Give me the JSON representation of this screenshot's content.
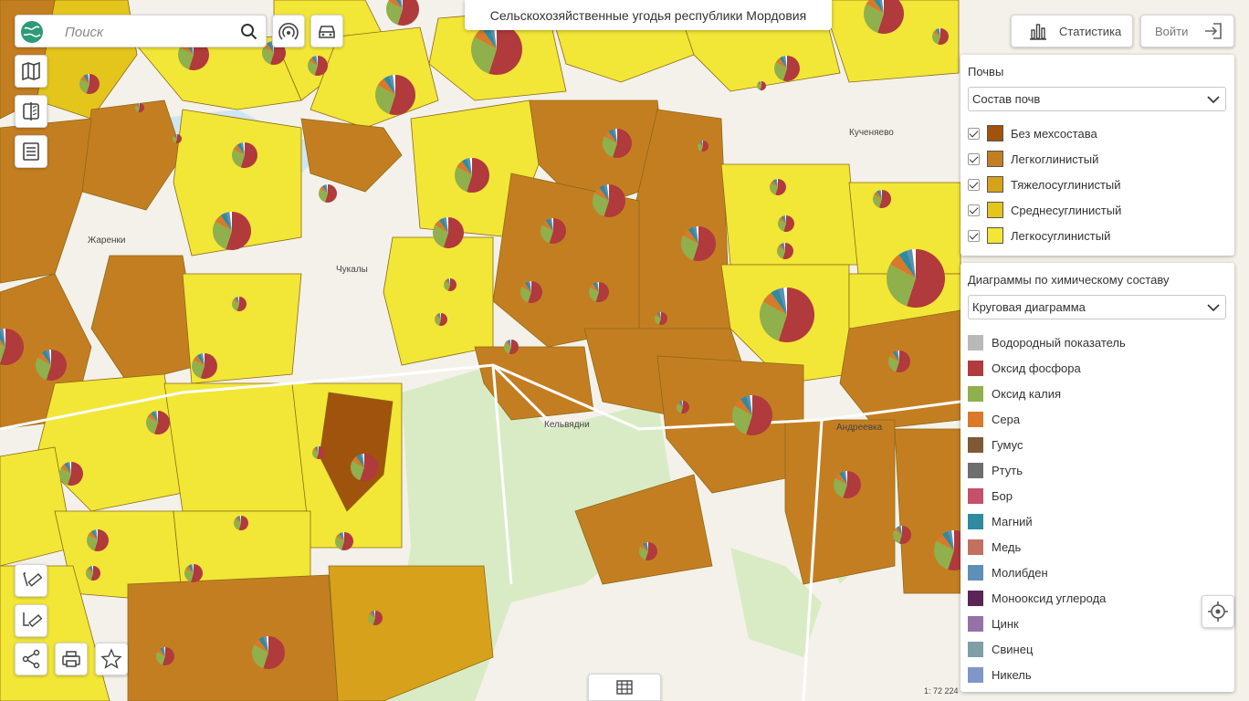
{
  "map": {
    "title": "Сельскохозяйственные угодья республики Мордовия",
    "place_labels": [
      "Жаренки",
      "Чукалы",
      "Кельвядни",
      "Андреевка",
      "Кученяево"
    ],
    "scale": "1: 72 224",
    "colors": {
      "background": "#f4f1ea",
      "forest": "#d9ebc5",
      "water": "#cfe6f3",
      "soil_bez": "#a0530c",
      "soil_legkoglin": "#c47e22",
      "soil_tyazh": "#d7a11b",
      "soil_sredne": "#e4c51c",
      "soil_legkosug": "#f2e637"
    }
  },
  "search": {
    "placeholder": "Поиск",
    "value": ""
  },
  "toolbar_left": {
    "logo_icon": "globe-logo-icon",
    "search_icon": "search-icon",
    "wireless_icon": "signal-icon",
    "car_icon": "car-icon",
    "map_icon": "map-icon",
    "compare_icon": "layers-compare-icon",
    "list_icon": "list-icon",
    "measure_line_icon": "ruler-line-icon",
    "measure_area_icon": "ruler-area-icon",
    "share_icon": "share-icon",
    "print_icon": "print-icon",
    "favorite_icon": "star-icon",
    "table_icon": "table-icon",
    "locate_icon": "locate-icon"
  },
  "topbar": {
    "statistics_label": "Статистика",
    "login_label": "Войти"
  },
  "soils_panel": {
    "title": "Почвы",
    "select_value": "Состав почв",
    "items": [
      {
        "label": "Без мехсостава",
        "color": "#a0530c",
        "checked": true
      },
      {
        "label": "Легкоглинистый",
        "color": "#c47e22",
        "checked": true
      },
      {
        "label": "Тяжелосуглинистый",
        "color": "#d7a11b",
        "checked": true
      },
      {
        "label": "Среднесуглинистый",
        "color": "#e4c51c",
        "checked": true
      },
      {
        "label": "Легкосуглинистый",
        "color": "#f2e637",
        "checked": true
      }
    ]
  },
  "chem_panel": {
    "title": "Диаграммы по химическому составу",
    "select_value": "Круговая диаграмма",
    "items": [
      {
        "label": "Водородный показатель",
        "color": "#b9b9b9"
      },
      {
        "label": "Оксид фосфора",
        "color": "#b03a3c"
      },
      {
        "label": "Оксид калия",
        "color": "#8fb04c"
      },
      {
        "label": "Сера",
        "color": "#d9792a"
      },
      {
        "label": "Гумус",
        "color": "#7e5837"
      },
      {
        "label": "Ртуть",
        "color": "#6e6e6e"
      },
      {
        "label": "Бор",
        "color": "#c4506a"
      },
      {
        "label": "Магний",
        "color": "#2f8b9f"
      },
      {
        "label": "Медь",
        "color": "#c27060"
      },
      {
        "label": "Молибден",
        "color": "#5e8fb7"
      },
      {
        "label": "Монооксид углерода",
        "color": "#5a2456"
      },
      {
        "label": "Цинк",
        "color": "#9670a9"
      },
      {
        "label": "Свинец",
        "color": "#7f9ea5"
      },
      {
        "label": "Никель",
        "color": "#7f96c7"
      }
    ]
  }
}
